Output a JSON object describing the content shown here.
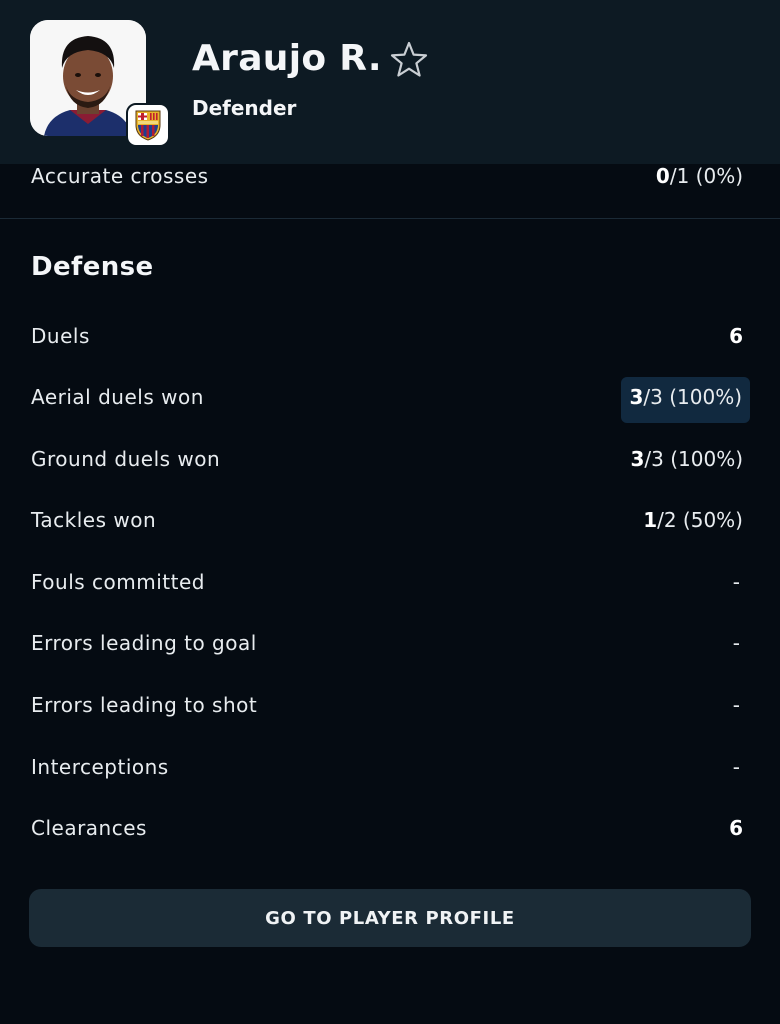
{
  "player": {
    "name": "Araujo R.",
    "position": "Defender",
    "favorite_icon": "star-outline-icon",
    "avatar_icon": "player-photo",
    "club_icon": "fc-barcelona-crest"
  },
  "partial_row": {
    "label": "Accurate crosses",
    "value_bold": "0",
    "value_rest": "/1 (0%)"
  },
  "section": {
    "title": "Defense",
    "rows": [
      {
        "label": "Duels",
        "value_bold": "6",
        "value_rest": ""
      },
      {
        "label": "Aerial duels won",
        "value_bold": "3",
        "value_rest": "/3 (100%)",
        "highlighted": true
      },
      {
        "label": "Ground duels won",
        "value_bold": "3",
        "value_rest": "/3 (100%)"
      },
      {
        "label": "Tackles won",
        "value_bold": "1",
        "value_rest": "/2 (50%)"
      },
      {
        "label": "Fouls committed",
        "value_bold": "",
        "value_rest": "-"
      },
      {
        "label": "Errors leading to goal",
        "value_bold": "",
        "value_rest": "-"
      },
      {
        "label": "Errors leading to shot",
        "value_bold": "",
        "value_rest": "-"
      },
      {
        "label": "Interceptions",
        "value_bold": "",
        "value_rest": "-"
      },
      {
        "label": "Clearances",
        "value_bold": "6",
        "value_rest": ""
      }
    ]
  },
  "actions": {
    "profile_button": "GO TO PLAYER PROFILE"
  },
  "colors": {
    "background": "#050b12",
    "header": "#0d1a23",
    "highlight": "#11293f",
    "button": "#1b2b36"
  }
}
